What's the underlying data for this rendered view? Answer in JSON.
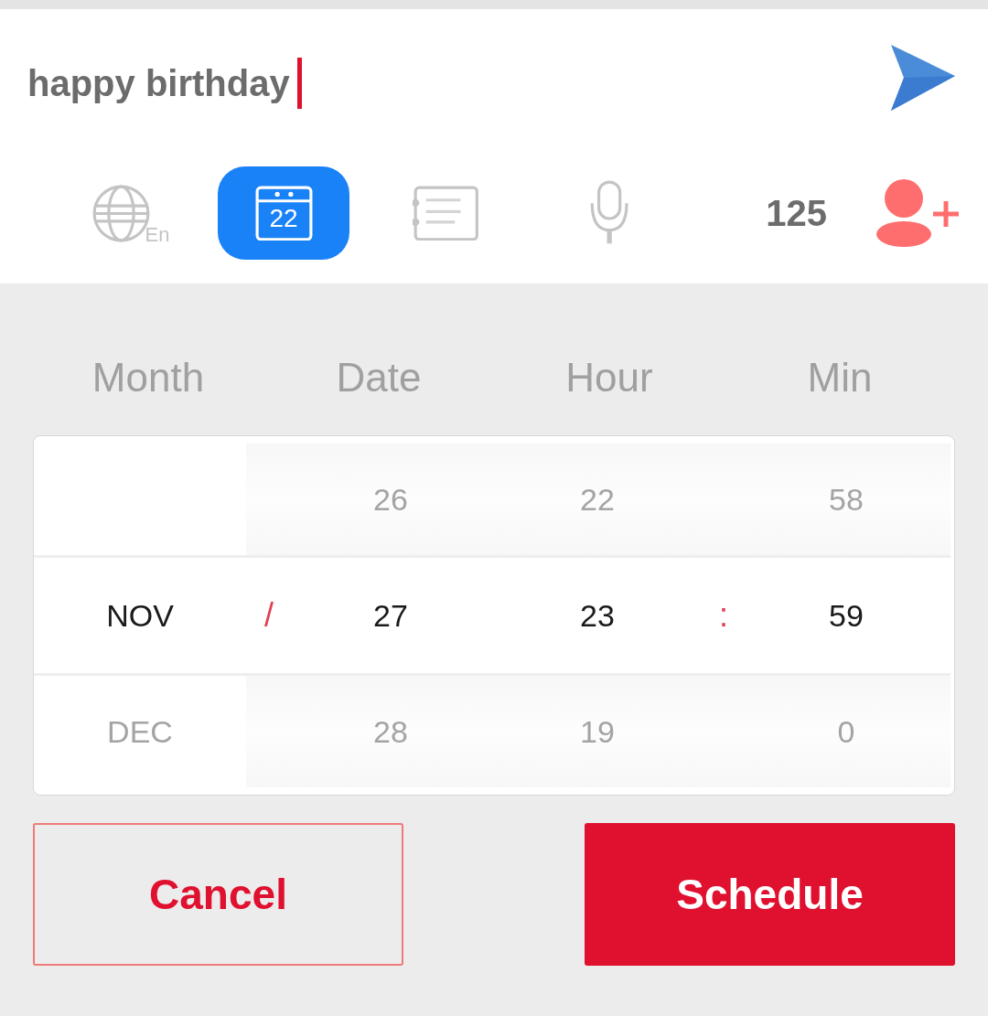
{
  "message": {
    "value": "happy birthday",
    "focused": true
  },
  "tools": [
    {
      "kind": "language",
      "label": "En",
      "selected": false
    },
    {
      "kind": "calendar",
      "label": "22",
      "selected": true
    },
    {
      "kind": "notes",
      "selected": false
    },
    {
      "kind": "voice",
      "selected": false
    }
  ],
  "counter": "125",
  "picker": {
    "columns": [
      "Month",
      "Date",
      "Hour",
      "Min"
    ],
    "separators": {
      "date": "/",
      "time": ":"
    },
    "rows": [
      {
        "date": "26",
        "hour": "22",
        "min": "58",
        "selected": false
      },
      {
        "month": "NOV",
        "date": "27",
        "hour": "23",
        "min": "59",
        "selected": true
      },
      {
        "month": "DEC",
        "date": "28",
        "hour": "19",
        "min": "0",
        "selected": false
      }
    ]
  },
  "buttons": [
    {
      "kind": "secondary",
      "label": "Cancel"
    },
    {
      "kind": "primary",
      "label": "Schedule"
    }
  ]
}
